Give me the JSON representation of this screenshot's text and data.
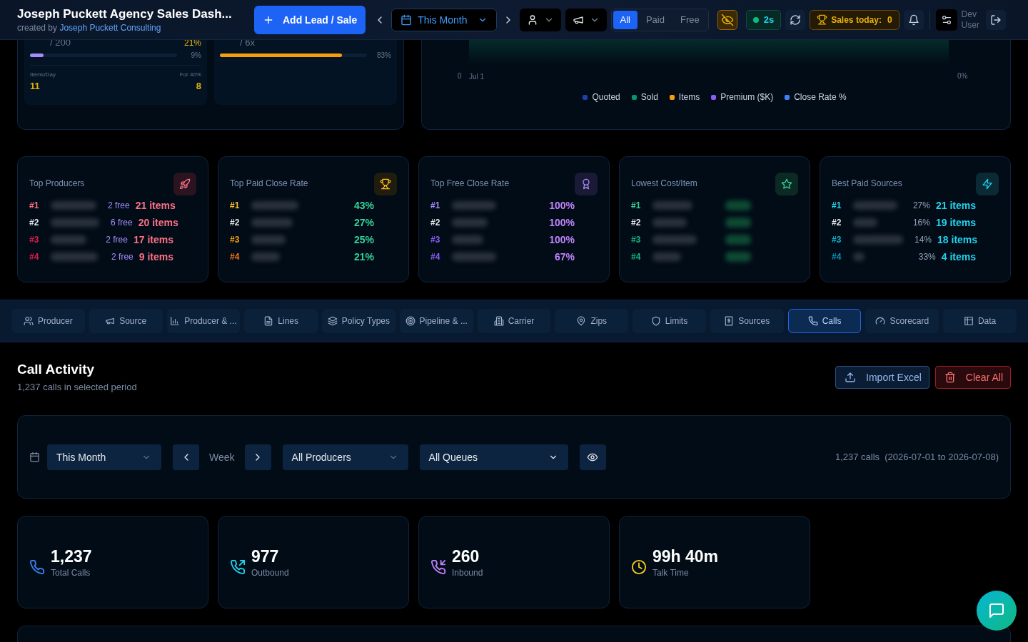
{
  "header": {
    "title": "Joseph Puckett Agency Sales Dash...",
    "subtitle_prefix": "created by",
    "subtitle_link": "Joseph Puckett Consulting",
    "add_button": "Add Lead / Sale",
    "period": "This Month",
    "segments": [
      {
        "label": "All",
        "selected": true
      },
      {
        "label": "Paid",
        "selected": false
      },
      {
        "label": "Free",
        "selected": false
      }
    ],
    "privacy_on": true,
    "live": "2s",
    "sales_label": "Sales today:",
    "sales_value": "0",
    "user": "Dev User"
  },
  "goals": [
    {
      "target": "/ 200",
      "pct": "21%",
      "color": "#a78bfa",
      "level": 0.09,
      "reading": "9%",
      "stats": [
        {
          "label": "Items/Day",
          "value": "11"
        },
        {
          "label": "For 40%",
          "value": "8"
        }
      ]
    },
    {
      "target": "/ 6x",
      "color": "#f59e0b",
      "level": 0.83,
      "reading": "83%"
    }
  ],
  "trend": {
    "left_tick": "0",
    "right_tick": "0%",
    "x_label": "Jul 1",
    "legend": [
      {
        "label": "Quoted",
        "color": "#1e40af"
      },
      {
        "label": "Sold",
        "color": "#059669"
      },
      {
        "label": "Items",
        "color": "#f59e0b"
      },
      {
        "label": "Premium ($K)",
        "color": "#8b5cf6"
      },
      {
        "label": "Close Rate %",
        "color": "#3b82f6"
      }
    ]
  },
  "leaders": [
    {
      "title": "Top Producers",
      "kind": "items",
      "rows": [
        {
          "rank": "#1",
          "color": "#fb7185",
          "free": "2 free",
          "value": "21 items"
        },
        {
          "rank": "#2",
          "color": "#e5e7eb",
          "free": "6 free",
          "value": "20 items"
        },
        {
          "rank": "#3",
          "color": "#e11d48",
          "free": "2 free",
          "value": "17 items"
        },
        {
          "rank": "#4",
          "color": "#e11d48",
          "free": "2 free",
          "value": "9 items"
        }
      ]
    },
    {
      "title": "Top Paid Close Rate",
      "kind": "rate",
      "rows": [
        {
          "rank": "#1",
          "color": "#fbbf24",
          "value": "43%"
        },
        {
          "rank": "#2",
          "color": "#e5e7eb",
          "value": "27%"
        },
        {
          "rank": "#3",
          "color": "#f59e0b",
          "value": "25%"
        },
        {
          "rank": "#4",
          "color": "#f97316",
          "value": "21%"
        }
      ]
    },
    {
      "title": "Top Free Close Rate",
      "kind": "rate",
      "rows": [
        {
          "rank": "#1",
          "color": "#a78bfa",
          "value": "100%"
        },
        {
          "rank": "#2",
          "color": "#e5e7eb",
          "value": "100%"
        },
        {
          "rank": "#3",
          "color": "#8b5cf6",
          "value": "100%"
        },
        {
          "rank": "#4",
          "color": "#8b5cf6",
          "value": "67%"
        }
      ]
    },
    {
      "title": "Lowest Cost/Item",
      "kind": "cost",
      "rows": [
        {
          "rank": "#1",
          "color": "#34d399"
        },
        {
          "rank": "#2",
          "color": "#e5e7eb"
        },
        {
          "rank": "#3",
          "color": "#10b981"
        },
        {
          "rank": "#4",
          "color": "#10b981"
        }
      ]
    },
    {
      "title": "Best Paid Sources",
      "kind": "source",
      "rows": [
        {
          "rank": "#1",
          "color": "#22d3ee",
          "share": "27%",
          "value": "21 items"
        },
        {
          "rank": "#2",
          "color": "#e5e7eb",
          "share": "16%",
          "value": "19 items"
        },
        {
          "rank": "#3",
          "color": "#06b6d4",
          "share": "14%",
          "value": "18 items"
        },
        {
          "rank": "#4",
          "color": "#0891b2",
          "share": "33%",
          "value": "4 items"
        }
      ]
    }
  ],
  "tabs": [
    {
      "label": "Producer",
      "selected": false
    },
    {
      "label": "Source",
      "selected": false
    },
    {
      "label": "Producer & ...",
      "selected": false
    },
    {
      "label": "Lines",
      "selected": false
    },
    {
      "label": "Policy Types",
      "selected": false
    },
    {
      "label": "Pipeline & ...",
      "selected": false
    },
    {
      "label": "Carrier",
      "selected": false
    },
    {
      "label": "Zips",
      "selected": false
    },
    {
      "label": "Limits",
      "selected": false
    },
    {
      "label": "Sources",
      "selected": false
    },
    {
      "label": "Calls",
      "selected": true
    },
    {
      "label": "Scorecard",
      "selected": false
    },
    {
      "label": "Data",
      "selected": false
    }
  ],
  "section": {
    "title": "Call Activity",
    "subtitle": "1,237 calls in selected period",
    "import_button": "Import Excel",
    "clear_button": "Clear All"
  },
  "filters": {
    "period": "This Month",
    "step": "Week",
    "producer": "All Producers",
    "queue": "All Queues",
    "summary": "1,237 calls  (2026-07-01 to 2026-07-08)"
  },
  "stats": [
    {
      "value": "1,237",
      "label": "Total Calls",
      "color": "#3b82f6"
    },
    {
      "value": "977",
      "label": "Outbound",
      "color": "#22d3ee"
    },
    {
      "value": "260",
      "label": "Inbound",
      "color": "#c084fc"
    },
    {
      "value": "99h 40m",
      "label": "Talk Time",
      "color": "#facc15"
    }
  ]
}
